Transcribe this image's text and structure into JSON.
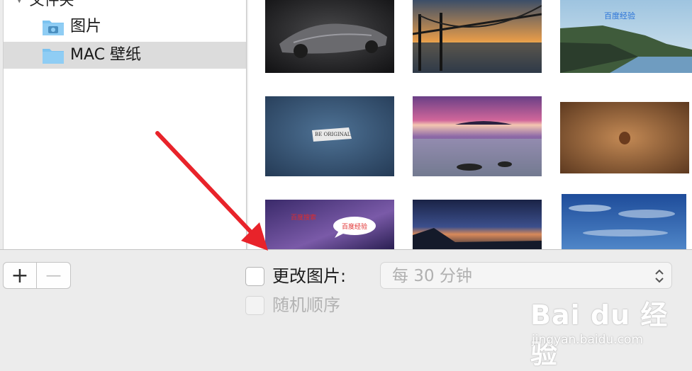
{
  "sidebar": {
    "header_label": "文件夹",
    "items": [
      {
        "label": "图片",
        "icon": "camera-folder-icon"
      },
      {
        "label": "MAC 壁纸",
        "icon": "folder-icon",
        "selected": true
      }
    ]
  },
  "grid": {
    "thumbnail_texts": {
      "cliffs_watermark": "百度经验",
      "paper_label": "BE ORIGINAL",
      "galaxy_red": "百度搜索",
      "galaxy_bubble": "百度经验"
    }
  },
  "bottom": {
    "add_label": "+",
    "remove_label": "—",
    "change_picture_label": "更改图片:",
    "change_picture_checked": false,
    "random_order_label": "随机顺序",
    "random_order_checked": false,
    "interval_value": "每 30 分钟"
  },
  "watermark": {
    "logo": "Bai du 经验",
    "url": "jingyan.baidu.com"
  },
  "colors": {
    "arrow": "#e8232a",
    "folder": "#7cc3f0",
    "selected_row": "#dcdcdc"
  }
}
